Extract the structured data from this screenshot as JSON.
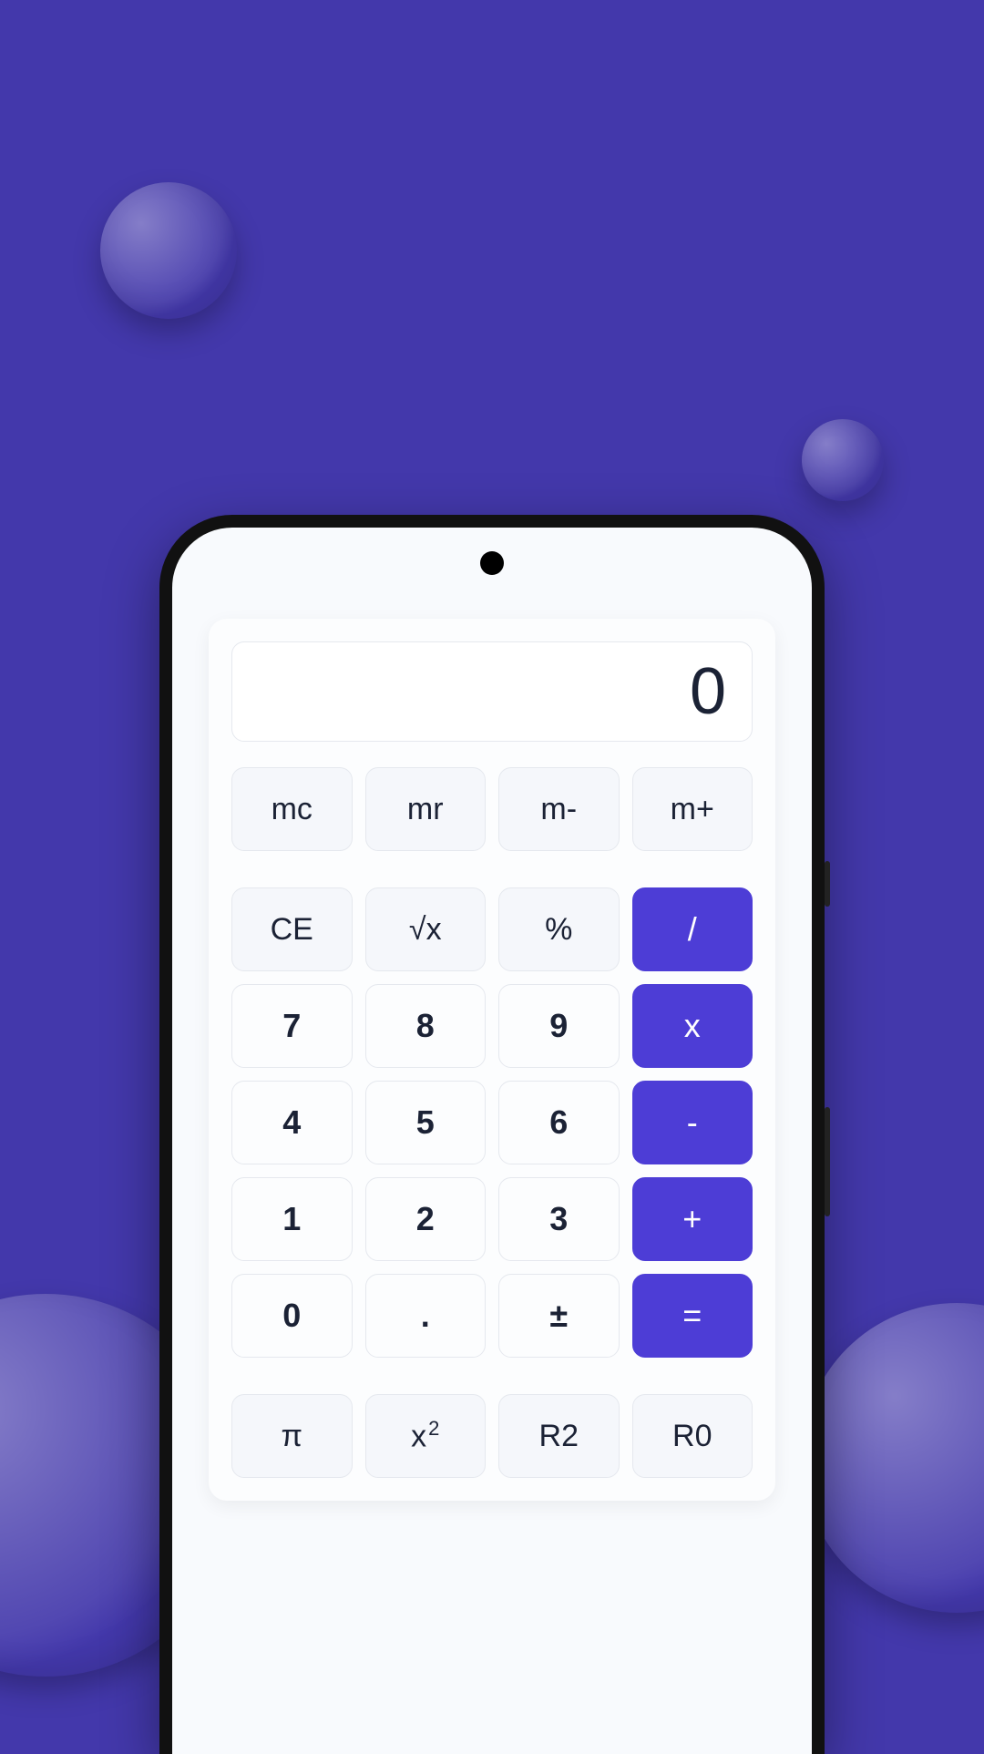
{
  "display": {
    "value": "0"
  },
  "keys": {
    "mc": "mc",
    "mr": "mr",
    "mminus": "m-",
    "mplus": "m+",
    "ce": "CE",
    "sqrt": "√x",
    "percent": "%",
    "divide": "/",
    "n7": "7",
    "n8": "8",
    "n9": "9",
    "multiply": "x",
    "n4": "4",
    "n5": "5",
    "n6": "6",
    "minus": "-",
    "n1": "1",
    "n2": "2",
    "n3": "3",
    "plus": "+",
    "n0": "0",
    "dot": ".",
    "plusminus": "±",
    "equals": "=",
    "pi": "π",
    "square_base": "x",
    "square_exp": "2",
    "r2": "R2",
    "r0": "R0"
  }
}
